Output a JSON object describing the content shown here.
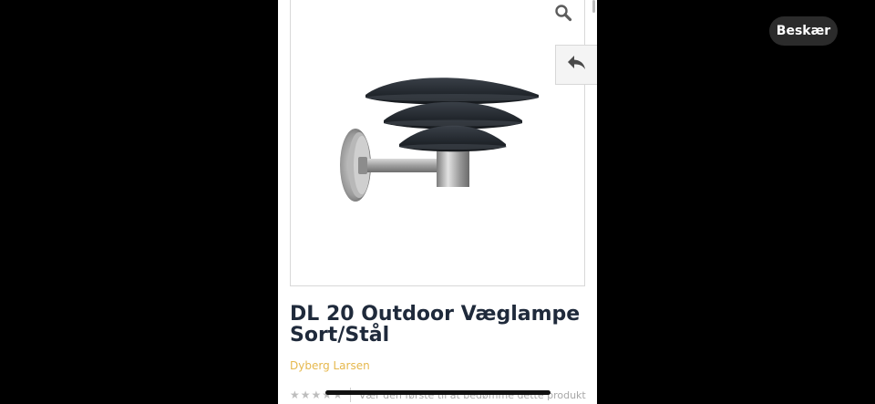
{
  "crop_button": {
    "label": "Beskær"
  },
  "product": {
    "title": "DL 20 Outdoor Væglampe Sort/Stål",
    "brand": "Dyberg Larsen",
    "rating": {
      "stars": 0,
      "max_stars": 5,
      "prompt_text": "Vær den første til at bedømme dette produkt"
    }
  },
  "icons": {
    "zoom": "magnifier-icon",
    "back": "reply-arrow-icon",
    "star": "star-icon"
  },
  "colors": {
    "title": "#1f2a3b",
    "brand": "#e6b84d",
    "lamp_shade": "#262b31",
    "lamp_steel": "#a9a9a9"
  }
}
